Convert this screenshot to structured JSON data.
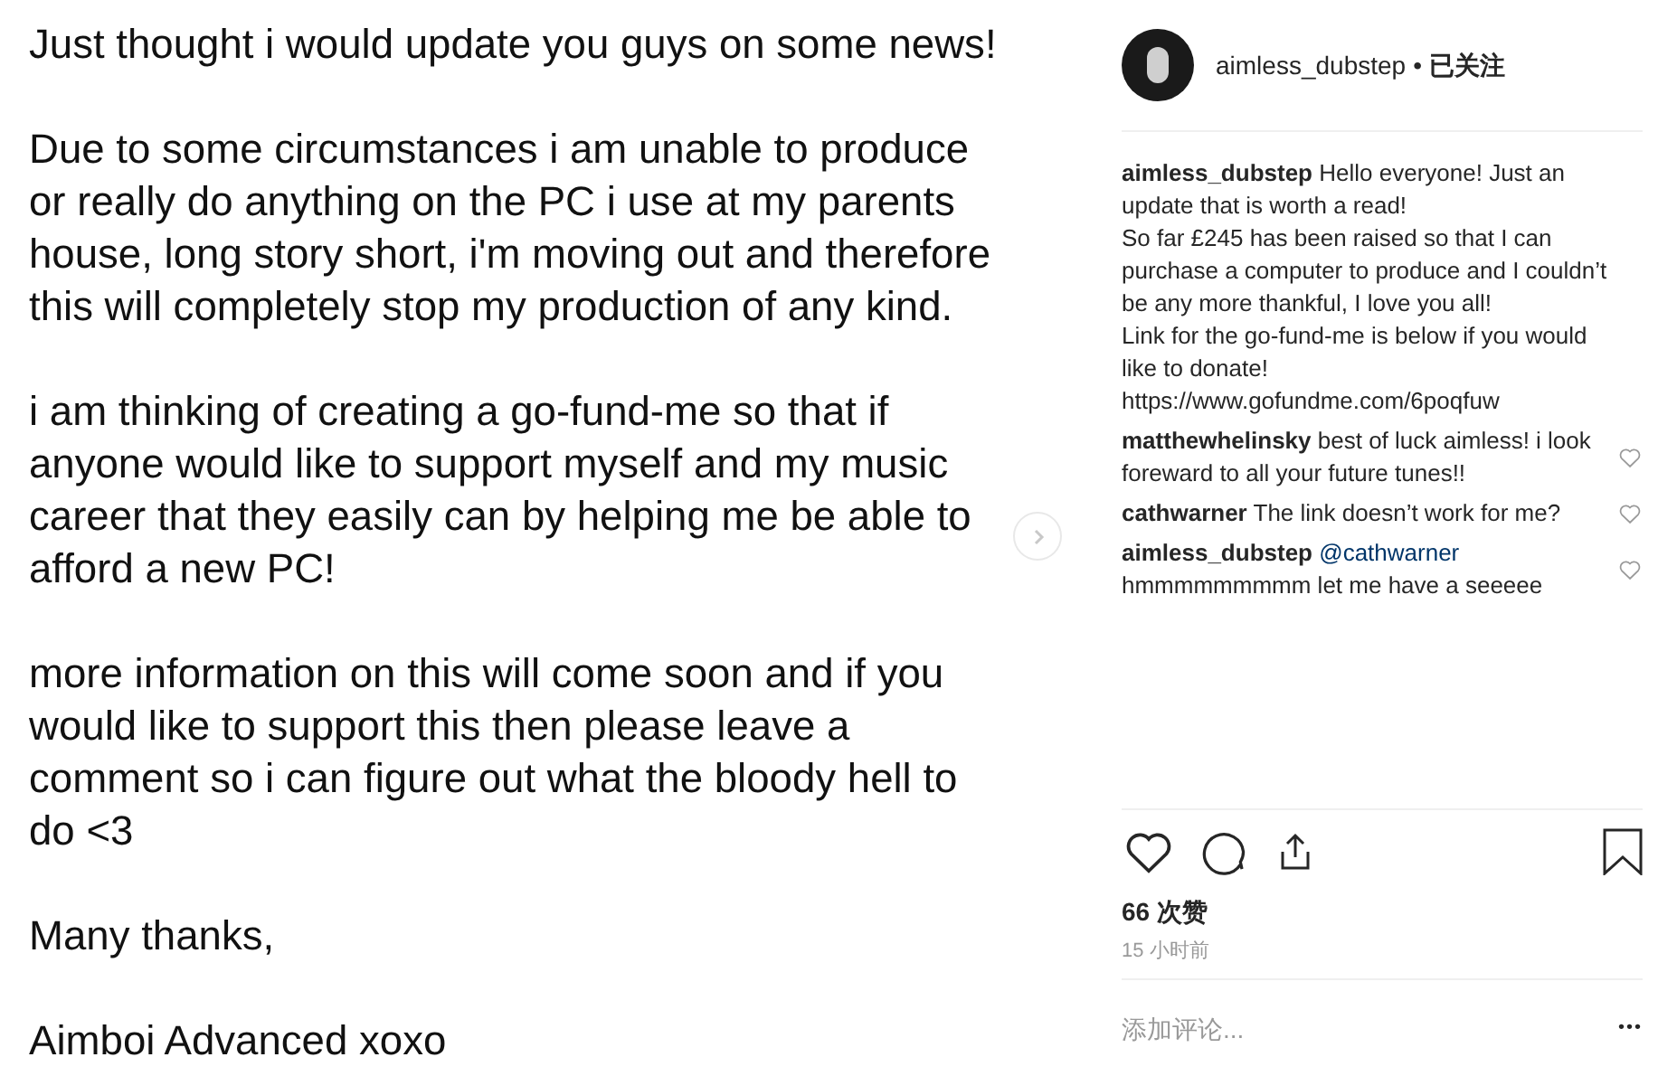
{
  "note": {
    "paragraphs": [
      "Just thought i would update you guys on some news!",
      "Due to some circumstances i am unable to produce or really do anything on the PC i use at my parents house, long story short, i'm moving out and therefore this will completely stop my production of any kind.",
      "i am thinking of creating a go-fund-me so that if anyone would like to support myself and my music career that they easily can by helping me be able to afford a new PC!",
      "more information on this will come soon and if you would like to support this then please leave a comment so i can figure out what the bloody hell to do <3",
      "Many thanks,",
      "Aimboi Advanced xoxo"
    ]
  },
  "header": {
    "username": "aimless_dubstep",
    "separator": "•",
    "follow_status": "已关注"
  },
  "caption": {
    "username": "aimless_dubstep",
    "lines": [
      "Hello everyone! Just an update that is worth a read!",
      "So far £245 has been raised so that I can purchase a computer to produce and I couldn’t be any more thankful, I love you all!",
      "Link for the go-fund-me is below if you would like to donate!",
      "https://www.gofundme.com/6poqfuw"
    ]
  },
  "comments": [
    {
      "username": "matthewhelinsky",
      "text": "best of luck aimless! i look foreward to all your future tunes!!",
      "liked": false
    },
    {
      "username": "cathwarner",
      "text": "The link doesn’t work for me?",
      "liked": false
    },
    {
      "username": "aimless_dubstep",
      "mention": "@cathwarner",
      "text": "hmmmmmmmmm let me have a seeeee",
      "liked": false
    }
  ],
  "actions": {
    "liked": false,
    "saved": false
  },
  "likes": "66 次赞",
  "time": "15 小时前",
  "comment_field": {
    "placeholder": "添加评论..."
  },
  "more": "•••"
}
